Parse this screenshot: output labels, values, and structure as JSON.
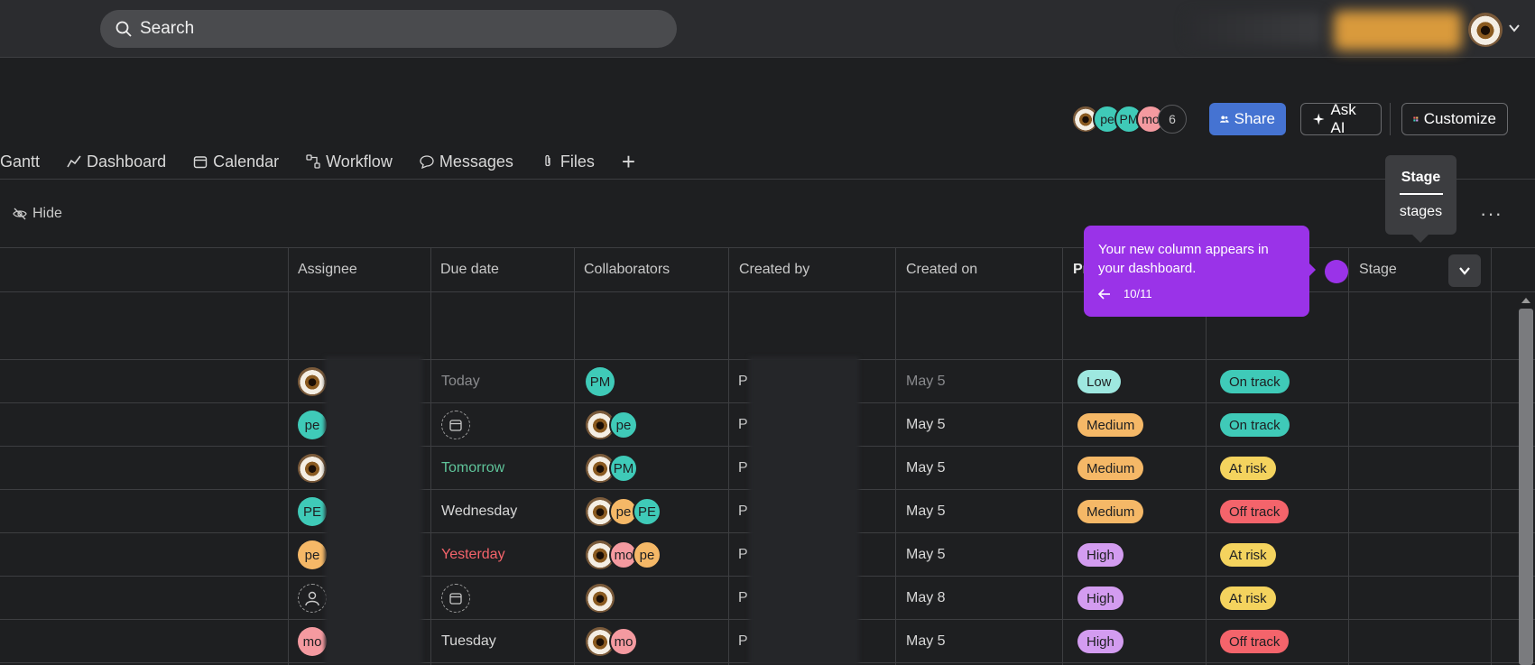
{
  "topbar": {
    "search_placeholder": "Search"
  },
  "header": {
    "faces": [
      {
        "label": "",
        "color": "eye"
      },
      {
        "label": "pe",
        "color": "#3fcab8"
      },
      {
        "label": "PM",
        "color": "#3fcab8"
      },
      {
        "label": "mo",
        "color": "#f49aa0"
      },
      {
        "label": "6",
        "color": "count"
      }
    ],
    "share": "Share",
    "ask_ai": "Ask AI",
    "customize": "Customize"
  },
  "tabs": [
    "Gantt",
    "Dashboard",
    "Calendar",
    "Workflow",
    "Messages",
    "Files"
  ],
  "toolbar": {
    "hide": "Hide"
  },
  "columns": {
    "assignee": "Assignee",
    "due_date": "Due date",
    "collaborators": "Collaborators",
    "created_by": "Created by",
    "created_on": "Created on",
    "priority": "Pr",
    "stage": "Stage"
  },
  "tooltip": {
    "message": "Your new column appears in your dashboard.",
    "step": "10/11"
  },
  "stage_popover": {
    "title": "Stage",
    "subtitle": "stages"
  },
  "rows": [
    {
      "assignee": {
        "label": "",
        "color": "eye"
      },
      "due": "Today",
      "due_color": "#8a8b8e",
      "due_empty": false,
      "collab": [
        {
          "label": "PM",
          "color": "#3fcab8"
        }
      ],
      "created_by": "P",
      "created_on": "May 5",
      "priority": "Low",
      "priority_color": "#9ee8e0",
      "status": "On track",
      "status_color": "#3fcab8",
      "dim": true
    },
    {
      "assignee": {
        "label": "pe",
        "color": "#3fcab8"
      },
      "due": "",
      "due_color": "#c9c9c9",
      "due_empty": true,
      "collab": [
        {
          "label": "",
          "color": "eye"
        },
        {
          "label": "pe",
          "color": "#3fcab8"
        }
      ],
      "created_by": "P",
      "created_on": "May 5",
      "priority": "Medium",
      "priority_color": "#f5b867",
      "status": "On track",
      "status_color": "#3fcab8"
    },
    {
      "assignee": {
        "label": "",
        "color": "eye"
      },
      "due": "Tomorrow",
      "due_color": "#5fc49a",
      "due_empty": false,
      "collab": [
        {
          "label": "",
          "color": "eye"
        },
        {
          "label": "PM",
          "color": "#3fcab8"
        }
      ],
      "created_by": "P",
      "created_on": "May 5",
      "priority": "Medium",
      "priority_color": "#f5b867",
      "status": "At risk",
      "status_color": "#f4d35e"
    },
    {
      "assignee": {
        "label": "PE",
        "color": "#3fcab8"
      },
      "due": "Wednesday",
      "due_color": "#d8d8d8",
      "due_empty": false,
      "collab": [
        {
          "label": "",
          "color": "eye"
        },
        {
          "label": "pe",
          "color": "#f5b867"
        },
        {
          "label": "PE",
          "color": "#3fcab8"
        }
      ],
      "created_by": "P",
      "created_on": "May 5",
      "priority": "Medium",
      "priority_color": "#f5b867",
      "status": "Off track",
      "status_color": "#f4646b"
    },
    {
      "assignee": {
        "label": "pe",
        "color": "#f5b867"
      },
      "due": "Yesterday",
      "due_color": "#f4646b",
      "due_empty": false,
      "collab": [
        {
          "label": "",
          "color": "eye"
        },
        {
          "label": "mo",
          "color": "#f49aa0"
        },
        {
          "label": "pe",
          "color": "#f5b867"
        }
      ],
      "created_by": "P",
      "created_on": "May 5",
      "priority": "High",
      "priority_color": "#d39cf0",
      "status": "At risk",
      "status_color": "#f4d35e"
    },
    {
      "assignee": {
        "label": "",
        "color": "empty"
      },
      "due": "",
      "due_color": "#c9c9c9",
      "due_empty": true,
      "collab": [
        {
          "label": "",
          "color": "eye"
        }
      ],
      "created_by": "P",
      "created_on": "May 8",
      "priority": "High",
      "priority_color": "#d39cf0",
      "status": "At risk",
      "status_color": "#f4d35e"
    },
    {
      "assignee": {
        "label": "mo",
        "color": "#f49aa0"
      },
      "due": "Tuesday",
      "due_color": "#d8d8d8",
      "due_empty": false,
      "collab": [
        {
          "label": "",
          "color": "eye"
        },
        {
          "label": "mo",
          "color": "#f49aa0"
        }
      ],
      "created_by": "P",
      "created_on": "May 5",
      "priority": "High",
      "priority_color": "#d39cf0",
      "status": "Off track",
      "status_color": "#f4646b"
    }
  ]
}
